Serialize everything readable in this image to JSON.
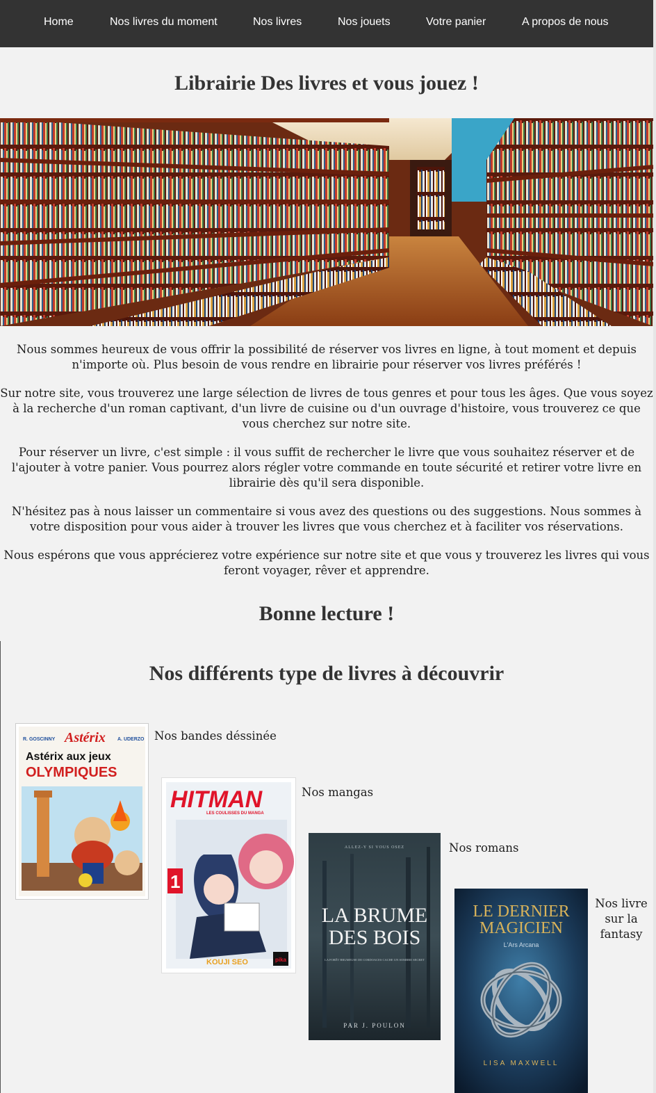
{
  "nav": {
    "items": [
      "Home",
      "Nos livres du moment",
      "Nos livres",
      "Nos jouets",
      "Votre panier",
      "A propos de nous"
    ]
  },
  "header": {
    "title": "Librairie Des livres et vous jouez !"
  },
  "banner": {
    "alt": "Intérieur de librairie"
  },
  "intro": {
    "paragraphs": [
      "Nous sommes heureux de vous offrir la possibilité de réserver vos livres en ligne, à tout moment et depuis n'importe où. Plus besoin de vous rendre en librairie pour réserver vos livres préférés !",
      "Sur notre site, vous trouverez une large sélection de livres de tous genres et pour tous les âges. Que vous soyez à la recherche d'un roman captivant, d'un livre de cuisine ou d'un ouvrage d'histoire, vous trouverez ce que vous cherchez sur notre site.",
      "Pour réserver un livre, c'est simple : il vous suffit de rechercher le livre que vous souhaitez réserver et de l'ajouter à votre panier. Vous pourrez alors régler votre commande en toute sécurité et retirer votre livre en librairie dès qu'il sera disponible.",
      "N'hésitez pas à nous laisser un commentaire si vous avez des questions ou des suggestions. Nous sommes à votre disposition pour vous aider à trouver les livres que vous cherchez et à faciliter vos réservations.",
      "Nous espérons que vous apprécierez votre expérience sur notre site et que vous y trouverez les livres qui vous feront voyager, rêver et apprendre."
    ],
    "closing": "Bonne lecture !"
  },
  "types": {
    "title": "Nos différents type de livres à découvrir",
    "items": [
      {
        "caption": "Nos bandes déssinée",
        "cover": {
          "top_left": "R. GOSCINNY",
          "logo": "Astérix",
          "top_right": "A. UDERZO",
          "title_line1": "Astérix aux jeux",
          "title_line2": "OLYMPIQUES"
        }
      },
      {
        "caption": "Nos mangas",
        "cover": {
          "title": "HITMAN",
          "subtitle": "LES COULISSES DU MANGA",
          "volume": "1",
          "author": "KOUJI SEO",
          "publisher": "pika"
        }
      },
      {
        "caption": "Nos romans",
        "cover": {
          "tagline": "ALLEZ-Y SI VOUS OSEZ",
          "title_line1": "LA BRUME",
          "title_line2": "DES BOIS",
          "blurb": "LA FORÊT BRUMEUSE DE CORDOACES CACHE UN SOMBRE SECRET",
          "author": "PAR J. POULON"
        }
      },
      {
        "caption": "Nos livre sur la fantasy",
        "cover": {
          "title_line1": "LE DERNIER",
          "title_line2": "MAGICIEN",
          "subtitle": "L'Ars Arcana",
          "author": "LISA MAXWELL"
        }
      }
    ]
  },
  "colors": {
    "nav_bg": "#333333",
    "page_bg": "#f2f2f2",
    "heading": "#333333"
  }
}
